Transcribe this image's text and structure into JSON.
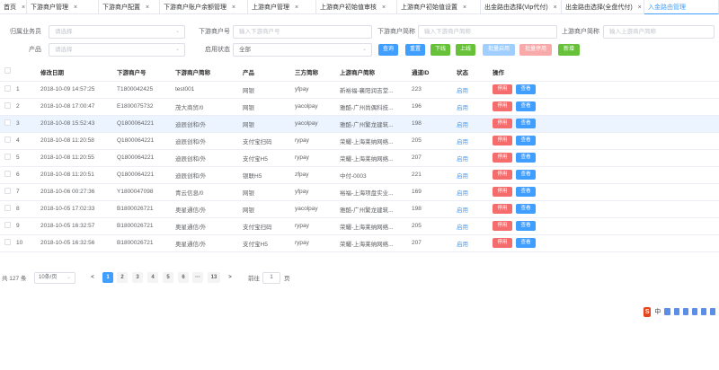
{
  "tabs": [
    {
      "label": "首页"
    },
    {
      "label": "下游商户管理"
    },
    {
      "label": "下游商户配置"
    },
    {
      "label": "下游商户账户余额管理"
    },
    {
      "label": "上游商户管理"
    },
    {
      "label": "上游商户初始值审核"
    },
    {
      "label": "上游商户初始值设置"
    },
    {
      "label": "出金路由选择(Vip代付)"
    },
    {
      "label": "出金路由选择(全盘代付)"
    },
    {
      "label": "入金路由管理"
    }
  ],
  "filters": {
    "agent_label": "归属业务员",
    "agent_placeholder": "请选择",
    "down_no_label": "下游商户号",
    "down_no_placeholder": "输入下游商户号",
    "down_name_label": "下游商户简称",
    "down_name_placeholder": "输入下游商户简称",
    "up_name_label": "上游商户简称",
    "up_name_placeholder": "输入上游商户简称",
    "product_label": "产品",
    "product_placeholder": "请选择",
    "enabled_label": "启用状态",
    "enabled_value": "全部"
  },
  "buttons": {
    "query": "查询",
    "reset": "重置",
    "offline": "下线",
    "online": "上线",
    "batch_enable": "批量启用",
    "batch_disable": "批量停用",
    "add": "新增"
  },
  "columns": [
    "修改日期",
    "下游商户号",
    "下游商户简称",
    "产品",
    "三方简称",
    "上游商户简称",
    "通道ID",
    "状态",
    "操作"
  ],
  "rows": [
    {
      "idx": "1",
      "date": "2018-10-09 14:57:25",
      "down_no": "T1800042425",
      "down_name": "test001",
      "product": "网银",
      "third": "yfpay",
      "up_name": "新裕福-襄阳润吉堂...",
      "channel": "223",
      "status": "启用"
    },
    {
      "idx": "2",
      "date": "2018-10-08 17:00:47",
      "down_no": "E1800075732",
      "down_name": "茂大商贸/0",
      "product": "网银",
      "third": "yacolpay",
      "up_name": "雅酷-广州尚偶科技...",
      "channel": "196",
      "status": "启用"
    },
    {
      "idx": "3",
      "date": "2018-10-08 15:52:43",
      "down_no": "Q1800064221",
      "down_name": "迪辰创和/外",
      "product": "网银",
      "third": "yacolpay",
      "up_name": "雅酷-广州繁龙建筑...",
      "channel": "198",
      "status": "启用"
    },
    {
      "idx": "4",
      "date": "2018-10-08 11:20:58",
      "down_no": "Q1800064221",
      "down_name": "迪辰创和/外",
      "product": "支付宝扫码",
      "third": "rypay",
      "up_name": "荣耀-上海莱纳网络...",
      "channel": "205",
      "status": "启用"
    },
    {
      "idx": "5",
      "date": "2018-10-08 11:20:55",
      "down_no": "Q1800064221",
      "down_name": "迪辰创和/外",
      "product": "支付宝H5",
      "third": "rypay",
      "up_name": "荣耀-上海莱纳网络...",
      "channel": "207",
      "status": "启用"
    },
    {
      "idx": "6",
      "date": "2018-10-08 11:20:51",
      "down_no": "Q1800064221",
      "down_name": "迪辰创和/外",
      "product": "银联H5",
      "third": "zfpay",
      "up_name": "中付-0003",
      "channel": "221",
      "status": "启用"
    },
    {
      "idx": "7",
      "date": "2018-10-06 00:27:36",
      "down_no": "Y1800047098",
      "down_name": "青云信息/0",
      "product": "网银",
      "third": "yfpay",
      "up_name": "裕福-上海项盘实业...",
      "channel": "169",
      "status": "启用"
    },
    {
      "idx": "8",
      "date": "2018-10-05 17:02:33",
      "down_no": "B1800026721",
      "down_name": "奥星通信/外",
      "product": "网银",
      "third": "yacolpay",
      "up_name": "雅酷-广州繁龙建筑...",
      "channel": "198",
      "status": "启用"
    },
    {
      "idx": "9",
      "date": "2018-10-05 16:32:57",
      "down_no": "B1800026721",
      "down_name": "奥星通信/外",
      "product": "支付宝扫码",
      "third": "rypay",
      "up_name": "荣耀-上海莱纳网络...",
      "channel": "205",
      "status": "启用"
    },
    {
      "idx": "10",
      "date": "2018-10-05 16:32:56",
      "down_no": "B1800026721",
      "down_name": "奥星通信/外",
      "product": "支付宝H5",
      "third": "rypay",
      "up_name": "荣耀-上海莱纳网络...",
      "channel": "207",
      "status": "启用"
    }
  ],
  "row_actions": {
    "disable": "停用",
    "view": "查看"
  },
  "pager": {
    "total": "共 127 条",
    "size": "10条/页",
    "prev": "<",
    "next": ">",
    "pages": [
      "1",
      "2",
      "3",
      "4",
      "5",
      "6",
      "···",
      "13"
    ],
    "goto": "前往",
    "goto_value": "1",
    "page_unit": "页"
  },
  "ime": {
    "logo": "S",
    "mode": "中"
  },
  "colors": {
    "primary": "#409eff",
    "success": "#67c23a",
    "danger": "#f56c6c",
    "highlight": "#ecf5ff"
  }
}
